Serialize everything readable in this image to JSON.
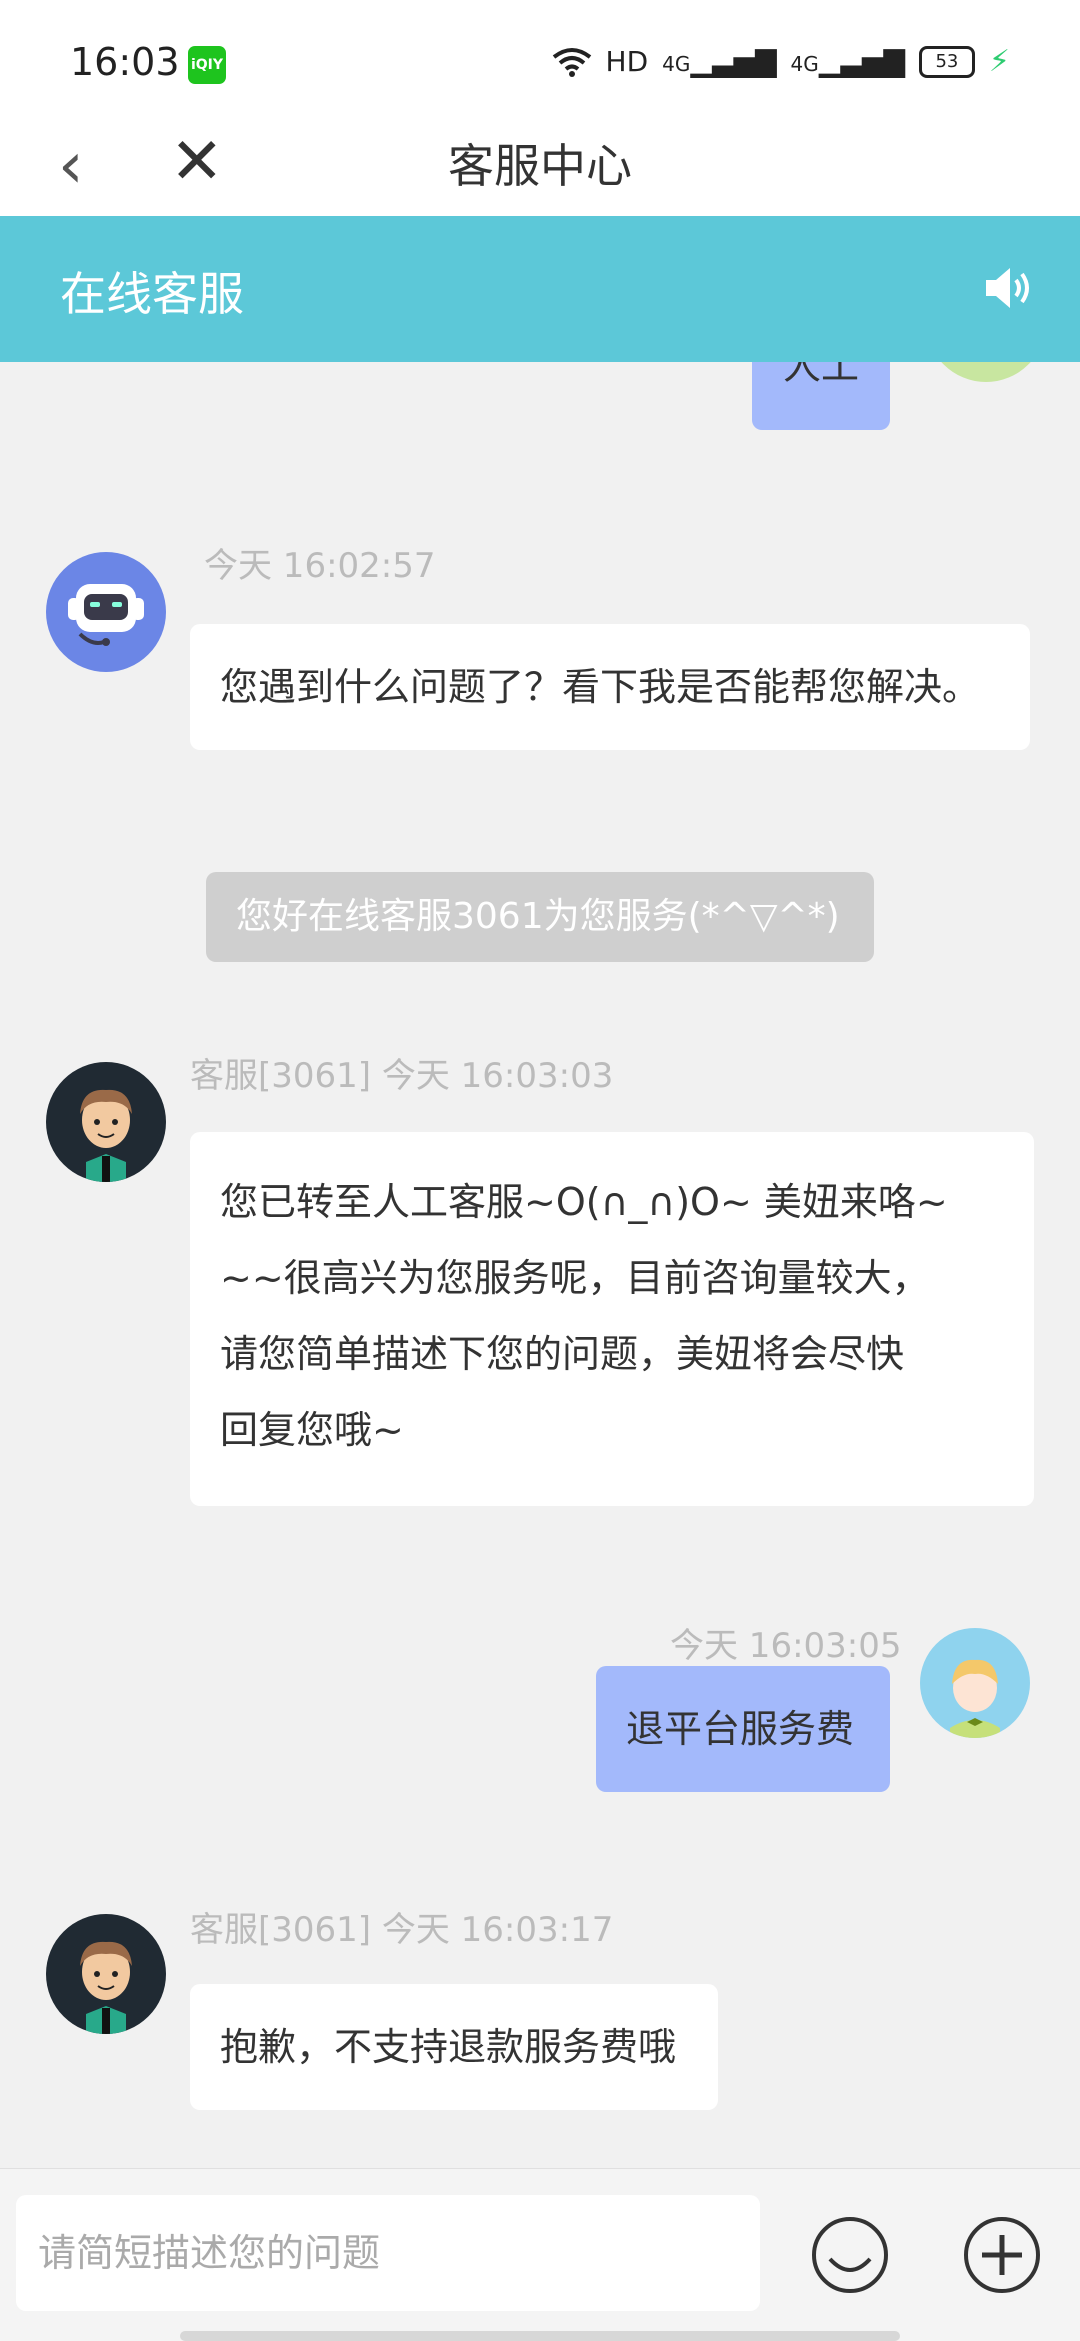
{
  "status_bar": {
    "time": "16:03",
    "app_badge": "iQIY",
    "network_hd": "HD",
    "network_1": "4G",
    "network_2": "4G",
    "battery": "53"
  },
  "nav": {
    "title": "客服中心"
  },
  "header": {
    "title": "在线客服"
  },
  "messages": {
    "partial_user_text": "人工",
    "bot_timestamp": "今天 16:02:57",
    "bot_text": "您遇到什么问题了？看下我是否能帮您解决。",
    "system_text": "您好在线客服3061为您服务(*^▽^*)",
    "agent1_timestamp": "客服[3061]  今天 16:03:03",
    "agent1_line1": "您已转至人工客服~O(∩_∩)O~ 美妞来咯~",
    "agent1_line2": "~~很高兴为您服务呢，目前咨询量较大，",
    "agent1_line3": "请您简单描述下您的问题，美妞将会尽快",
    "agent1_line4": "回复您哦~",
    "user_timestamp": "今天 16:03:05",
    "user_text": "退平台服务费",
    "agent2_timestamp": "客服[3061]  今天 16:03:17",
    "agent2_text": "抱歉，不支持退款服务费哦"
  },
  "input": {
    "placeholder": "请简短描述您的问题"
  },
  "colors": {
    "header_bg": "#5cc8d8",
    "user_bubble": "#a3b9fb",
    "system_bubble": "#cfcfcf"
  }
}
